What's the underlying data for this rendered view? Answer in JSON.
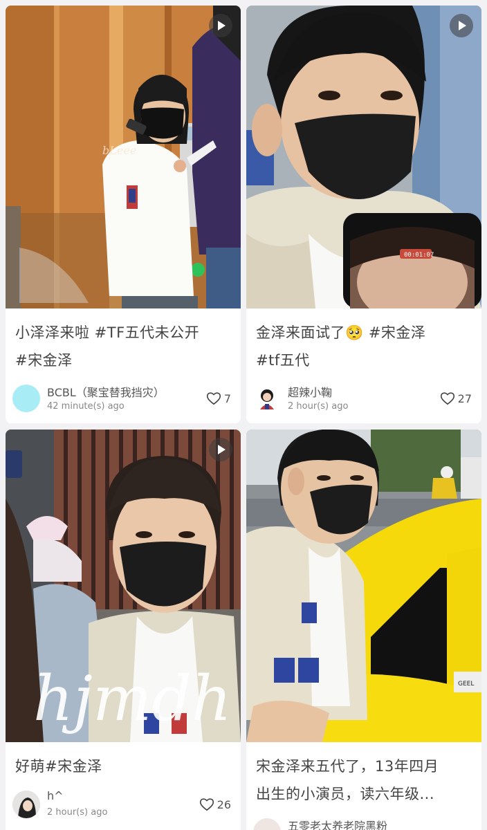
{
  "feed": {
    "posts": [
      {
        "title_line1": "小泽泽来啦 #TF五代未公开",
        "title_line2": "#宋金泽",
        "author": "BCBL（聚宝替我挡灾）",
        "time": "42 minute(s) ago",
        "likes": "7",
        "avatar_color": "#a8ecf6",
        "has_video": true,
        "watermark": "bLeee"
      },
      {
        "title_line1": "金泽来面试了🥺 #宋金泽",
        "title_line2": "#tf五代",
        "author": "超辣小鞠",
        "time": "2 hour(s) ago",
        "likes": "27",
        "has_video": true,
        "phone_timer": "00:01:07"
      },
      {
        "title_line1": "好萌#宋金泽",
        "title_line2": "",
        "author": "h^",
        "time": "2 hour(s) ago",
        "likes": "26",
        "has_video": true,
        "watermark": "hjmdh"
      },
      {
        "title_line1": "宋金泽来五代了，13年四月",
        "title_line2": "出生的小演员，读六年级...",
        "author": "五零老太养老院黑粉",
        "time": "",
        "likes": "",
        "has_video": false,
        "car_text": "GEEL"
      }
    ]
  },
  "colors": {
    "background": "#f2f2f4",
    "card": "#ffffff",
    "taxi_yellow": "#f5d90a"
  },
  "icons": {
    "like": "heart-outline-icon",
    "video": "play-icon"
  }
}
